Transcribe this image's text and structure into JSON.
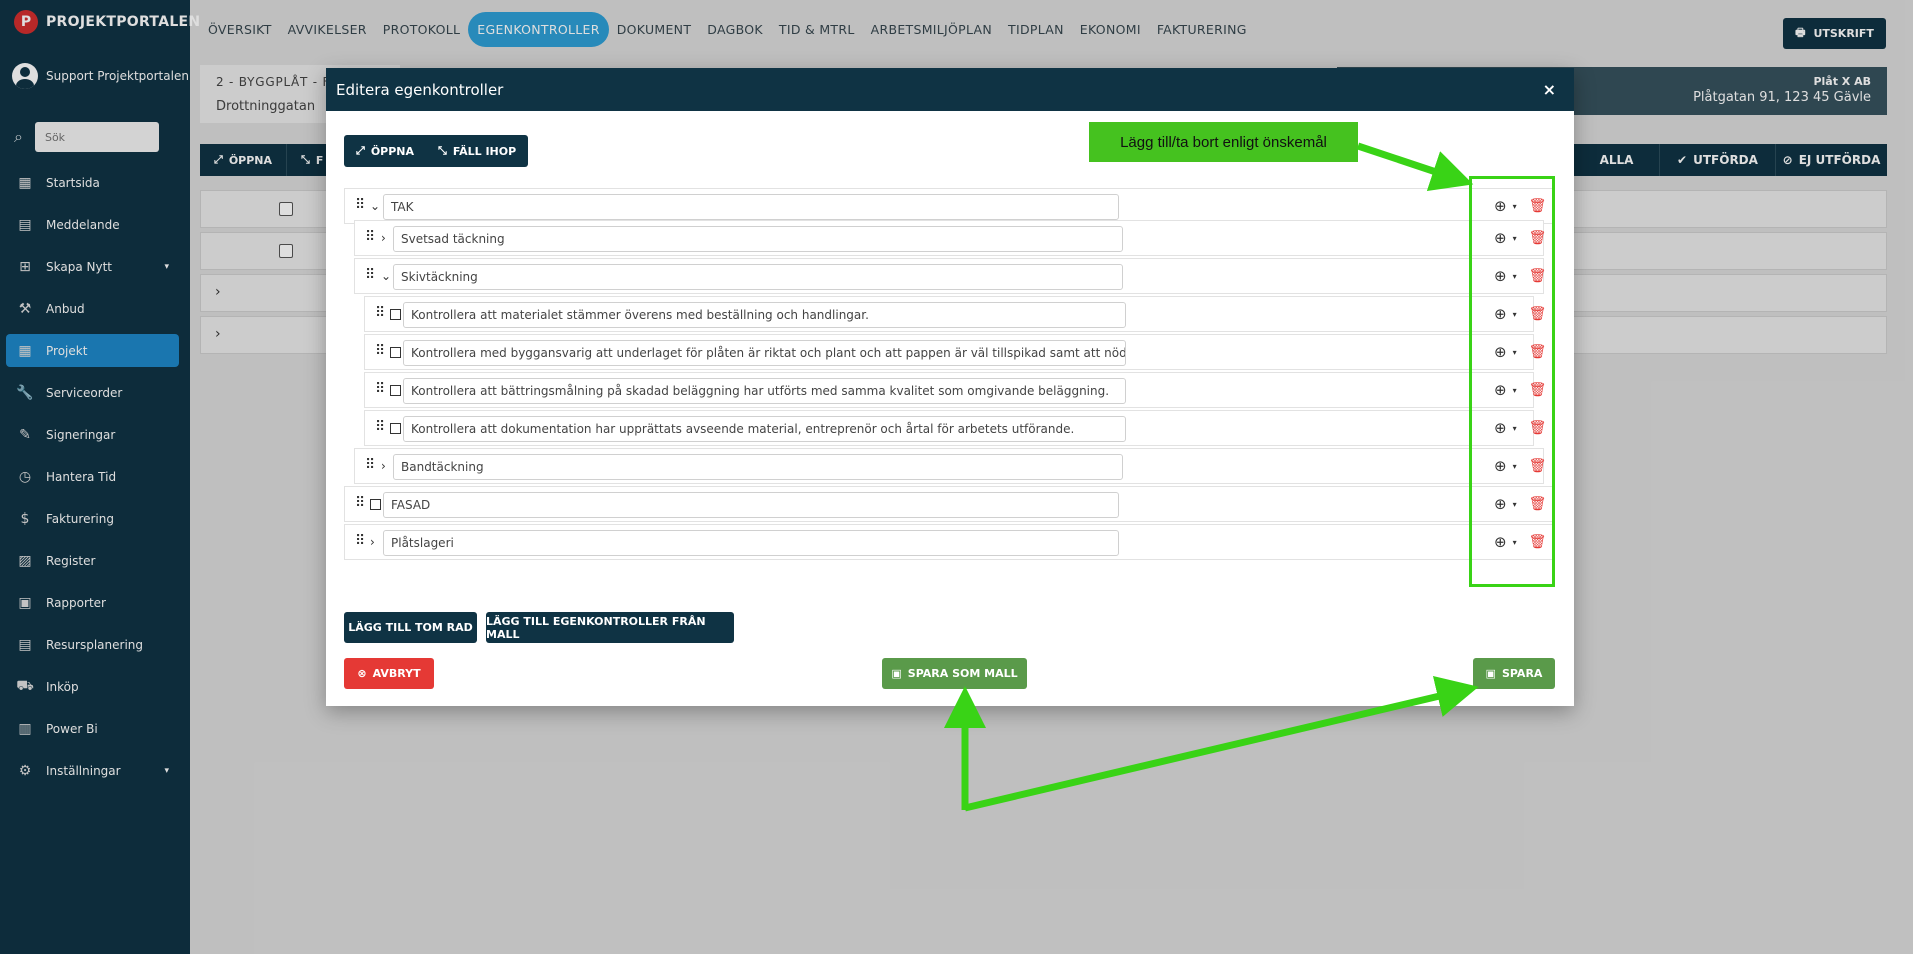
{
  "brand": {
    "name": "PROJEKTPORTALEN",
    "logo_letter": "P"
  },
  "user": {
    "name": "Support Projektportalen"
  },
  "search": {
    "placeholder": "Sök"
  },
  "nav": [
    {
      "label": "Startsida",
      "icon": "dashboard-icon",
      "glyph": "▦"
    },
    {
      "label": "Meddelande",
      "icon": "message-icon",
      "glyph": "▤"
    },
    {
      "label": "Skapa Nytt",
      "icon": "add-box-icon",
      "glyph": "⊞",
      "caret": "▾"
    },
    {
      "label": "Anbud",
      "icon": "gavel-icon",
      "glyph": "⚒"
    },
    {
      "label": "Projekt",
      "icon": "projects-icon",
      "glyph": "▦",
      "active": true
    },
    {
      "label": "Serviceorder",
      "icon": "wrench-icon",
      "glyph": "🔧"
    },
    {
      "label": "Signeringar",
      "icon": "pen-icon",
      "glyph": "✎"
    },
    {
      "label": "Hantera Tid",
      "icon": "clock-icon",
      "glyph": "◷"
    },
    {
      "label": "Fakturering",
      "icon": "dollar-icon",
      "glyph": "$"
    },
    {
      "label": "Register",
      "icon": "image-icon",
      "glyph": "▨"
    },
    {
      "label": "Rapporter",
      "icon": "calendar-icon",
      "glyph": "▣"
    },
    {
      "label": "Resursplanering",
      "icon": "calendar-grid-icon",
      "glyph": "▤"
    },
    {
      "label": "Inköp",
      "icon": "cart-icon",
      "glyph": "⛟"
    },
    {
      "label": "Power Bi",
      "icon": "chart-icon",
      "glyph": "▥"
    },
    {
      "label": "Inställningar",
      "icon": "gear-icon",
      "glyph": "⚙",
      "caret": "▾"
    }
  ],
  "tabs": [
    {
      "label": "ÖVERSIKT"
    },
    {
      "label": "AVVIKELSER"
    },
    {
      "label": "PROTOKOLL"
    },
    {
      "label": "EGENKONTROLLER",
      "active": true
    },
    {
      "label": "DOKUMENT"
    },
    {
      "label": "DAGBOK"
    },
    {
      "label": "TID & MTRL"
    },
    {
      "label": "ARBETSMILJÖPLAN"
    },
    {
      "label": "TIDPLAN"
    },
    {
      "label": "EKONOMI"
    },
    {
      "label": "FAKTURERING"
    }
  ],
  "print_button": "UTSKRIFT",
  "project": {
    "line1": "2 - BYGGPLÅT - F",
    "line2": "Drottninggatan"
  },
  "customer": {
    "name": "Plåt X AB",
    "address": "Plåtgatan 91, 123 45 Gävle"
  },
  "bg_toolbar": {
    "open": "ÖPPNA",
    "collapse_partial": "F"
  },
  "bg_filters": {
    "all": "ALLA",
    "done": "UTFÖRDA",
    "not_done": "EJ UTFÖRDA"
  },
  "modal": {
    "title": "Editera egenkontroller",
    "close": "×",
    "open_label": "ÖPPNA",
    "collapse_label": "FÄLL IHOP",
    "rows": [
      {
        "text": "TAK",
        "control": "chevron-down"
      },
      {
        "text": "Svetsad täckning",
        "control": "chevron-right"
      },
      {
        "text": "Skivtäckning",
        "control": "chevron-down"
      },
      {
        "text": "Kontrollera att materialet stämmer överens med beställning och handlingar.",
        "control": "checkbox"
      },
      {
        "text": "Kontrollera med byggansvarig att underlaget för plåten är riktat och plant och att pappen är väl tillspikad samt att nödvändiga fall finns.",
        "control": "checkbox"
      },
      {
        "text": "Kontrollera att bättringsmålning på skadad beläggning har utförts med samma kvalitet som omgivande beläggning.",
        "control": "checkbox"
      },
      {
        "text": "Kontrollera att dokumentation har upprättats avseende material, entreprenör och årtal för arbetets utförande.",
        "control": "checkbox"
      },
      {
        "text": "Bandtäckning",
        "control": "chevron-right"
      },
      {
        "text": "FASAD",
        "control": "checkbox"
      },
      {
        "text": "Plåtslageri",
        "control": "chevron-right"
      }
    ],
    "add_empty_row": "LÄGG TILL TOM RAD",
    "add_from_template": "LÄGG TILL EGENKONTROLLER FRÅN MALL",
    "cancel": "AVBRYT",
    "save_as_template": "SPARA SOM MALL",
    "save": "SPARA"
  },
  "annotation": {
    "text": "Lägg till/ta bort enligt önskemål",
    "color": "#39d316"
  }
}
